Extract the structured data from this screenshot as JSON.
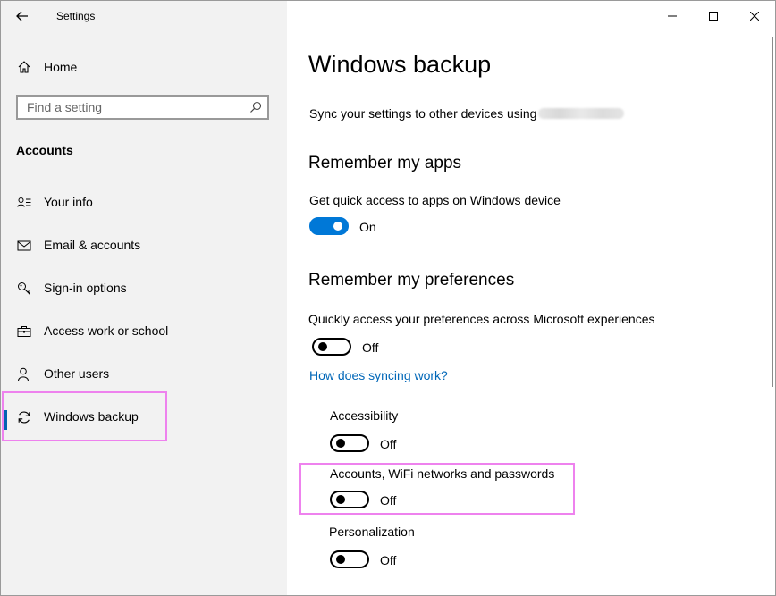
{
  "window": {
    "title": "Settings"
  },
  "sidebar": {
    "home_label": "Home",
    "search_placeholder": "Find a setting",
    "section_label": "Accounts",
    "items": [
      {
        "label": "Your info",
        "icon": "person-card-icon"
      },
      {
        "label": "Email & accounts",
        "icon": "mail-icon"
      },
      {
        "label": "Sign-in options",
        "icon": "key-icon"
      },
      {
        "label": "Access work or school",
        "icon": "briefcase-icon"
      },
      {
        "label": "Other users",
        "icon": "person-icon"
      },
      {
        "label": "Windows backup",
        "icon": "sync-icon",
        "selected": true
      }
    ]
  },
  "main": {
    "title": "Windows backup",
    "sync_desc": "Sync your settings to other devices using",
    "remember_apps": {
      "heading": "Remember my apps",
      "desc": "Get quick access to apps on Windows device",
      "toggle_state": "On",
      "toggle_on": true
    },
    "remember_prefs": {
      "heading": "Remember my preferences",
      "desc": "Quickly access your preferences across Microsoft experiences",
      "toggle_state": "Off",
      "toggle_on": false,
      "link": "How does syncing work?",
      "options": [
        {
          "label": "Accessibility",
          "state": "Off",
          "on": false
        },
        {
          "label": "Accounts, WiFi networks and passwords",
          "state": "Off",
          "on": false,
          "highlighted": true
        },
        {
          "label": "Personalization",
          "state": "Off",
          "on": false
        }
      ]
    }
  },
  "colors": {
    "accent": "#0078d7",
    "link": "#0067b8",
    "highlight": "#ee82ee",
    "sidebar_bg": "#f2f2f2"
  }
}
